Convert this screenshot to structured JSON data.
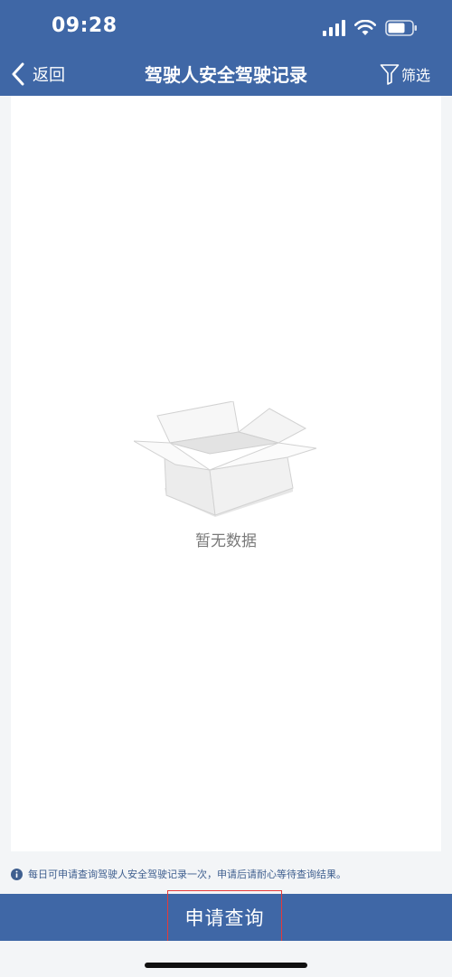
{
  "status_bar": {
    "time": "09:28"
  },
  "nav": {
    "back_label": "返回",
    "title": "驾驶人安全驾驶记录",
    "filter_label": "筛选"
  },
  "content": {
    "empty_text": "暂无数据"
  },
  "notice": {
    "text": "每日可申请查询驾驶人安全驾驶记录一次，申请后请耐心等待查询结果。"
  },
  "apply": {
    "label": "申请查询"
  },
  "colors": {
    "primary": "#3f67a6",
    "notice_text": "#3f5f8f",
    "highlight_border": "#e53a3a"
  }
}
